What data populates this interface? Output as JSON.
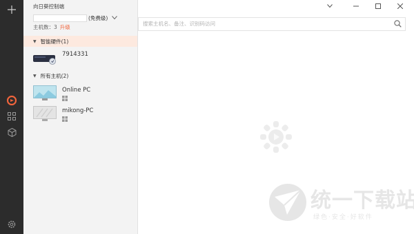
{
  "window": {
    "title": "向日葵控制端"
  },
  "account": {
    "level": "(免费级)",
    "host_count_label": "主机数：3",
    "upgrade_label": "升级"
  },
  "search": {
    "placeholder": "搜索主机名、备注、识别码访问"
  },
  "groups": [
    {
      "label": "智能硬件(1)",
      "hosts": [
        {
          "name": "7914331",
          "icon": "smart-hardware-device"
        }
      ]
    },
    {
      "label": "所有主机(2)",
      "hosts": [
        {
          "name": "Online PC",
          "icon": "monitor-online",
          "os": "windows"
        },
        {
          "name": "mikong-PC",
          "icon": "monitor-offline",
          "os": "windows"
        }
      ]
    }
  ],
  "rail": {
    "items": [
      "plus-icon",
      "sunflower-icon",
      "grid-icon",
      "cube-icon",
      "settings-icon"
    ]
  },
  "watermark_brand": {
    "main": "统一下载站",
    "sub": "绿色·安全·好软件"
  },
  "colors": {
    "accent": "#f0643c",
    "rail_bg": "#2c2c2c",
    "selected_group_bg": "#fde9df"
  }
}
